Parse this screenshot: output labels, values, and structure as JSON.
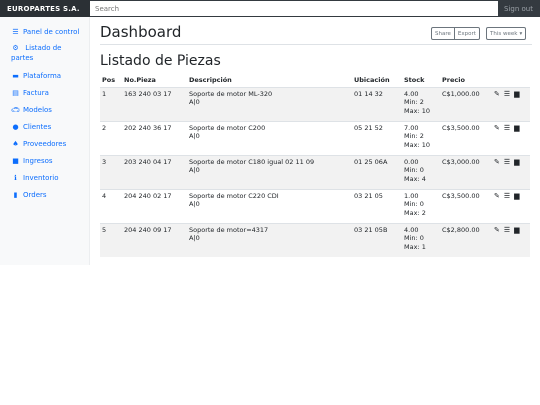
{
  "header": {
    "brand": "EUROPARTES S.A.",
    "search_placeholder": "Search",
    "signout": "Sign out"
  },
  "sidebar": {
    "items": [
      {
        "label": "Panel de control",
        "icon": "list-icon"
      },
      {
        "label": "Listado de partes",
        "icon": "parts-icon"
      },
      {
        "label": "Plataforma",
        "icon": "platform-icon"
      },
      {
        "label": "Factura",
        "icon": "invoice-icon"
      },
      {
        "label": "Modelos",
        "icon": "car-icon"
      },
      {
        "label": "Clientes",
        "icon": "user-icon"
      },
      {
        "label": "Proveedores",
        "icon": "bell-icon"
      },
      {
        "label": "Ingresos",
        "icon": "truck-icon"
      },
      {
        "label": "Inventorio",
        "icon": "info-icon"
      },
      {
        "label": "Orders",
        "icon": "file-icon"
      }
    ]
  },
  "main": {
    "title": "Dashboard",
    "share_label": "Share",
    "export_label": "Export",
    "week_label": "This week",
    "section_title": "Listado de Piezas"
  },
  "table": {
    "headers": [
      "Pos",
      "No.Pieza",
      "Descripción",
      "Ubicación",
      "Stock",
      "Precio"
    ],
    "rows": [
      {
        "pos": "1",
        "pieza": "163 240 03 17",
        "desc": "Soporte de motor ML-320",
        "desc2": "A|0",
        "ubic": "01 14 32",
        "stock": "4.00",
        "min": "Min: 2",
        "max": "Max: 10",
        "precio": "C$1,000.00"
      },
      {
        "pos": "2",
        "pieza": "202 240 36 17",
        "desc": "Soporte de motor C200",
        "desc2": "A|0",
        "ubic": "05 21 52",
        "stock": "7.00",
        "min": "Min: 2",
        "max": "Max: 10",
        "precio": "C$3,500.00"
      },
      {
        "pos": "3",
        "pieza": "203 240 04 17",
        "desc": "Soporte de motor C180 igual 02 11 09",
        "desc2": "A|0",
        "ubic": "01 25 06A",
        "stock": "0.00",
        "min": "Min: 0",
        "max": "Max: 4",
        "precio": "C$3,000.00"
      },
      {
        "pos": "4",
        "pieza": "204 240 02 17",
        "desc": "Soporte de motor C220 CDI",
        "desc2": "A|0",
        "ubic": "03 21 05",
        "stock": "1.00",
        "min": "Min: 0",
        "max": "Max: 2",
        "precio": "C$3,500.00"
      },
      {
        "pos": "5",
        "pieza": "204 240 09 17",
        "desc": "Soporte de motor=4317",
        "desc2": "A|0",
        "ubic": "03 21 05B",
        "stock": "4.00",
        "min": "Min: 0",
        "max": "Max: 1",
        "precio": "C$2,800.00"
      }
    ],
    "action_icons": [
      "pencil-icon",
      "menu-icon",
      "cart-icon"
    ]
  },
  "colors": {
    "topbar": "#343a40",
    "link": "#0d6efd",
    "stripe": "#f2f2f2"
  }
}
